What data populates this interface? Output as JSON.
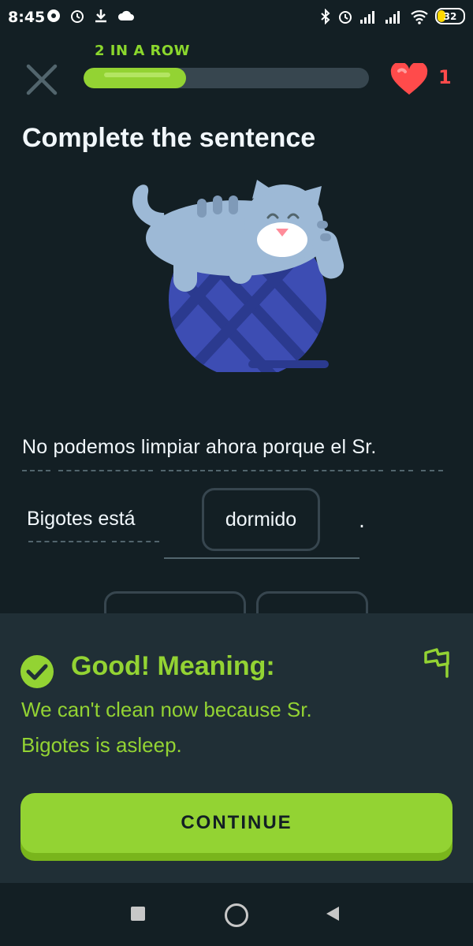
{
  "status_bar": {
    "time": "8:45",
    "battery": "32",
    "left_icons": [
      "notification-icon",
      "alarm-icon",
      "download-icon",
      "cloud-icon"
    ],
    "right_icons": [
      "bluetooth-icon",
      "alarm-icon",
      "signal-icon",
      "signal-icon",
      "wifi-icon",
      "battery-icon"
    ]
  },
  "header": {
    "streak_label": "2 IN A ROW",
    "progress": 0.36,
    "hearts": "1"
  },
  "exercise": {
    "title": "Complete the sentence",
    "sentence_line1": "No podemos limpiar ahora porque el Sr.",
    "sentence_word2": "Bigotes está",
    "answer": "dormido",
    "period": "."
  },
  "feedback": {
    "title": "Good! Meaning:",
    "meaning_line1": "We can't clean now because Sr.",
    "meaning_line2": "Bigotes is asleep.",
    "continue_label": "CONTINUE"
  },
  "colors": {
    "background": "#131f24",
    "green": "#93d333",
    "red": "#ff4b4b",
    "panel": "#202f36"
  }
}
